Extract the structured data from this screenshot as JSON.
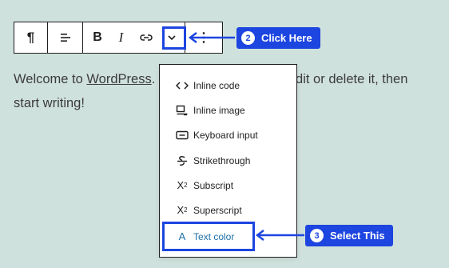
{
  "toolbar": {
    "paragraph_label": "¶",
    "bold_label": "B",
    "italic_label": "I",
    "options_label": "⋮"
  },
  "content": {
    "text_before": "Welcome to ",
    "link_text": "WordPress",
    "text_mid": ". This is your first post. Edit or delete it, then start writing!"
  },
  "dropdown": {
    "items": [
      {
        "icon": "code-icon",
        "label": "Inline code"
      },
      {
        "icon": "image-icon",
        "label": "Inline image"
      },
      {
        "icon": "keyboard-icon",
        "label": "Keyboard input"
      },
      {
        "icon": "strikethrough-icon",
        "label": "Strikethrough"
      },
      {
        "icon": "subscript-icon",
        "label": "Subscript",
        "glyph": "X",
        "sub": "2"
      },
      {
        "icon": "superscript-icon",
        "label": "Superscript",
        "glyph": "X",
        "sup": "2"
      },
      {
        "icon": "text-color-icon",
        "label": "Text color",
        "glyph": "A"
      }
    ]
  },
  "callouts": {
    "click_here": {
      "num": "2",
      "label": "Click Here"
    },
    "select_this": {
      "num": "3",
      "label": "Select This"
    }
  },
  "colors": {
    "accent": "#1d45e0",
    "background": "#cfe1dc",
    "selected_item": "#1d6fa8"
  }
}
